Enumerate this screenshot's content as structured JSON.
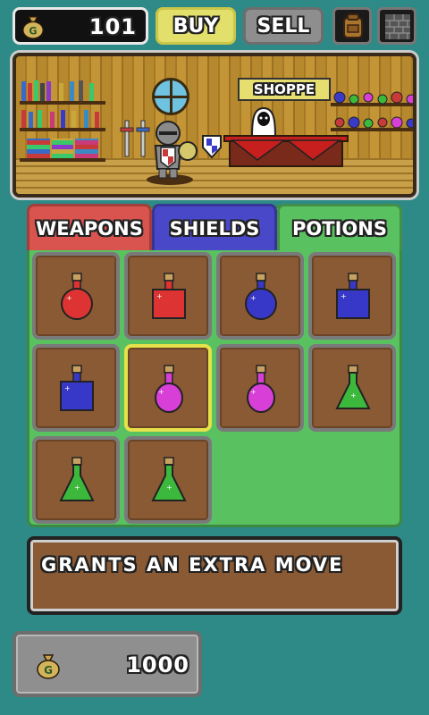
{
  "top_bar": {
    "gold": "101",
    "buy_label": "BUY",
    "sell_label": "SELL",
    "coin_symbol": "G"
  },
  "scene": {
    "sign_text": "SHOPPE"
  },
  "tabs": [
    {
      "label": "WEAPONS",
      "color": "#d9534f"
    },
    {
      "label": "SHIELDS",
      "color": "#4848c8"
    },
    {
      "label": "POTIONS",
      "color": "#5ac160",
      "active": true
    }
  ],
  "items": [
    {
      "icon": "red-round-potion-icon",
      "color": "#d33"
    },
    {
      "icon": "red-square-potion-icon",
      "color": "#d33"
    },
    {
      "icon": "blue-round-potion-icon",
      "color": "#3838c8"
    },
    {
      "icon": "blue-square-potion-icon",
      "color": "#3838c8"
    },
    {
      "icon": "blue-square-potion-icon",
      "color": "#3838c8"
    },
    {
      "icon": "pink-round-potion-icon",
      "color": "#d73fd7",
      "selected": true
    },
    {
      "icon": "pink-round-potion-icon",
      "color": "#d73fd7"
    },
    {
      "icon": "green-flask-potion-icon",
      "color": "#3cb83c"
    },
    {
      "icon": "green-flask-potion-icon",
      "color": "#3cb83c"
    },
    {
      "icon": "green-flask-potion-icon",
      "color": "#3cb83c"
    }
  ],
  "description": "GRANTS AN EXTRA MOVE",
  "price": {
    "value": "1000",
    "coin_symbol": "G"
  }
}
